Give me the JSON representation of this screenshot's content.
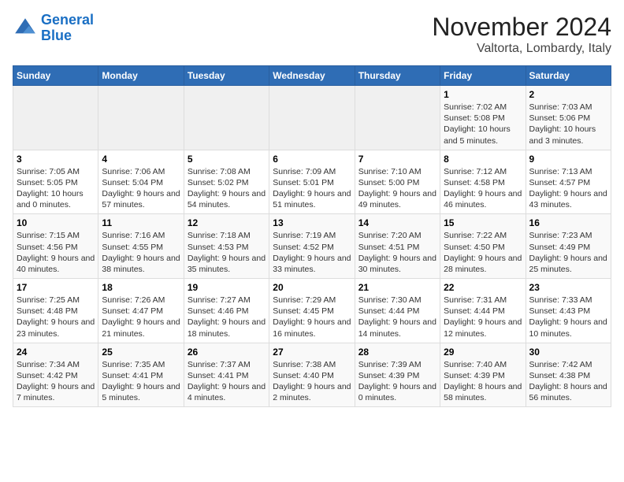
{
  "header": {
    "logo_line1": "General",
    "logo_line2": "Blue",
    "month": "November 2024",
    "location": "Valtorta, Lombardy, Italy"
  },
  "weekdays": [
    "Sunday",
    "Monday",
    "Tuesday",
    "Wednesday",
    "Thursday",
    "Friday",
    "Saturday"
  ],
  "weeks": [
    [
      {
        "day": "",
        "info": ""
      },
      {
        "day": "",
        "info": ""
      },
      {
        "day": "",
        "info": ""
      },
      {
        "day": "",
        "info": ""
      },
      {
        "day": "",
        "info": ""
      },
      {
        "day": "1",
        "info": "Sunrise: 7:02 AM\nSunset: 5:08 PM\nDaylight: 10 hours and 5 minutes."
      },
      {
        "day": "2",
        "info": "Sunrise: 7:03 AM\nSunset: 5:06 PM\nDaylight: 10 hours and 3 minutes."
      }
    ],
    [
      {
        "day": "3",
        "info": "Sunrise: 7:05 AM\nSunset: 5:05 PM\nDaylight: 10 hours and 0 minutes."
      },
      {
        "day": "4",
        "info": "Sunrise: 7:06 AM\nSunset: 5:04 PM\nDaylight: 9 hours and 57 minutes."
      },
      {
        "day": "5",
        "info": "Sunrise: 7:08 AM\nSunset: 5:02 PM\nDaylight: 9 hours and 54 minutes."
      },
      {
        "day": "6",
        "info": "Sunrise: 7:09 AM\nSunset: 5:01 PM\nDaylight: 9 hours and 51 minutes."
      },
      {
        "day": "7",
        "info": "Sunrise: 7:10 AM\nSunset: 5:00 PM\nDaylight: 9 hours and 49 minutes."
      },
      {
        "day": "8",
        "info": "Sunrise: 7:12 AM\nSunset: 4:58 PM\nDaylight: 9 hours and 46 minutes."
      },
      {
        "day": "9",
        "info": "Sunrise: 7:13 AM\nSunset: 4:57 PM\nDaylight: 9 hours and 43 minutes."
      }
    ],
    [
      {
        "day": "10",
        "info": "Sunrise: 7:15 AM\nSunset: 4:56 PM\nDaylight: 9 hours and 40 minutes."
      },
      {
        "day": "11",
        "info": "Sunrise: 7:16 AM\nSunset: 4:55 PM\nDaylight: 9 hours and 38 minutes."
      },
      {
        "day": "12",
        "info": "Sunrise: 7:18 AM\nSunset: 4:53 PM\nDaylight: 9 hours and 35 minutes."
      },
      {
        "day": "13",
        "info": "Sunrise: 7:19 AM\nSunset: 4:52 PM\nDaylight: 9 hours and 33 minutes."
      },
      {
        "day": "14",
        "info": "Sunrise: 7:20 AM\nSunset: 4:51 PM\nDaylight: 9 hours and 30 minutes."
      },
      {
        "day": "15",
        "info": "Sunrise: 7:22 AM\nSunset: 4:50 PM\nDaylight: 9 hours and 28 minutes."
      },
      {
        "day": "16",
        "info": "Sunrise: 7:23 AM\nSunset: 4:49 PM\nDaylight: 9 hours and 25 minutes."
      }
    ],
    [
      {
        "day": "17",
        "info": "Sunrise: 7:25 AM\nSunset: 4:48 PM\nDaylight: 9 hours and 23 minutes."
      },
      {
        "day": "18",
        "info": "Sunrise: 7:26 AM\nSunset: 4:47 PM\nDaylight: 9 hours and 21 minutes."
      },
      {
        "day": "19",
        "info": "Sunrise: 7:27 AM\nSunset: 4:46 PM\nDaylight: 9 hours and 18 minutes."
      },
      {
        "day": "20",
        "info": "Sunrise: 7:29 AM\nSunset: 4:45 PM\nDaylight: 9 hours and 16 minutes."
      },
      {
        "day": "21",
        "info": "Sunrise: 7:30 AM\nSunset: 4:44 PM\nDaylight: 9 hours and 14 minutes."
      },
      {
        "day": "22",
        "info": "Sunrise: 7:31 AM\nSunset: 4:44 PM\nDaylight: 9 hours and 12 minutes."
      },
      {
        "day": "23",
        "info": "Sunrise: 7:33 AM\nSunset: 4:43 PM\nDaylight: 9 hours and 10 minutes."
      }
    ],
    [
      {
        "day": "24",
        "info": "Sunrise: 7:34 AM\nSunset: 4:42 PM\nDaylight: 9 hours and 7 minutes."
      },
      {
        "day": "25",
        "info": "Sunrise: 7:35 AM\nSunset: 4:41 PM\nDaylight: 9 hours and 5 minutes."
      },
      {
        "day": "26",
        "info": "Sunrise: 7:37 AM\nSunset: 4:41 PM\nDaylight: 9 hours and 4 minutes."
      },
      {
        "day": "27",
        "info": "Sunrise: 7:38 AM\nSunset: 4:40 PM\nDaylight: 9 hours and 2 minutes."
      },
      {
        "day": "28",
        "info": "Sunrise: 7:39 AM\nSunset: 4:39 PM\nDaylight: 9 hours and 0 minutes."
      },
      {
        "day": "29",
        "info": "Sunrise: 7:40 AM\nSunset: 4:39 PM\nDaylight: 8 hours and 58 minutes."
      },
      {
        "day": "30",
        "info": "Sunrise: 7:42 AM\nSunset: 4:38 PM\nDaylight: 8 hours and 56 minutes."
      }
    ]
  ]
}
